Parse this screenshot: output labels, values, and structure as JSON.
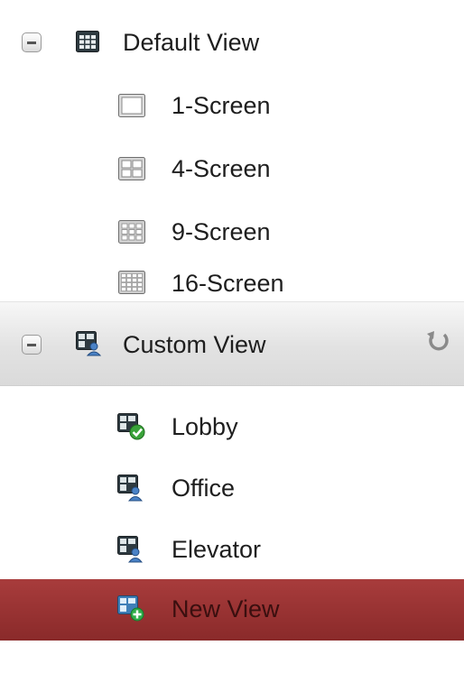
{
  "default_view": {
    "label": "Default View",
    "collapse_state": "expanded",
    "screens": [
      {
        "label": "1-Screen",
        "icon": "single-screen-icon"
      },
      {
        "label": "4-Screen",
        "icon": "four-screen-grid-icon"
      },
      {
        "label": "9-Screen",
        "icon": "nine-screen-grid-icon"
      },
      {
        "label": "16-Screen",
        "icon": "sixteen-screen-grid-icon"
      }
    ]
  },
  "custom_view": {
    "label": "Custom View",
    "collapse_state": "expanded",
    "views": [
      {
        "label": "Lobby",
        "icon": "view-active-icon"
      },
      {
        "label": "Office",
        "icon": "view-user-icon"
      },
      {
        "label": "Elevator",
        "icon": "view-user-icon"
      },
      {
        "label": "New View",
        "icon": "view-add-icon",
        "selected": true
      }
    ]
  },
  "colors": {
    "selected_row": "#8f2e2e",
    "header_bg": "#e3e3e3",
    "text": "#1e1e1e"
  }
}
